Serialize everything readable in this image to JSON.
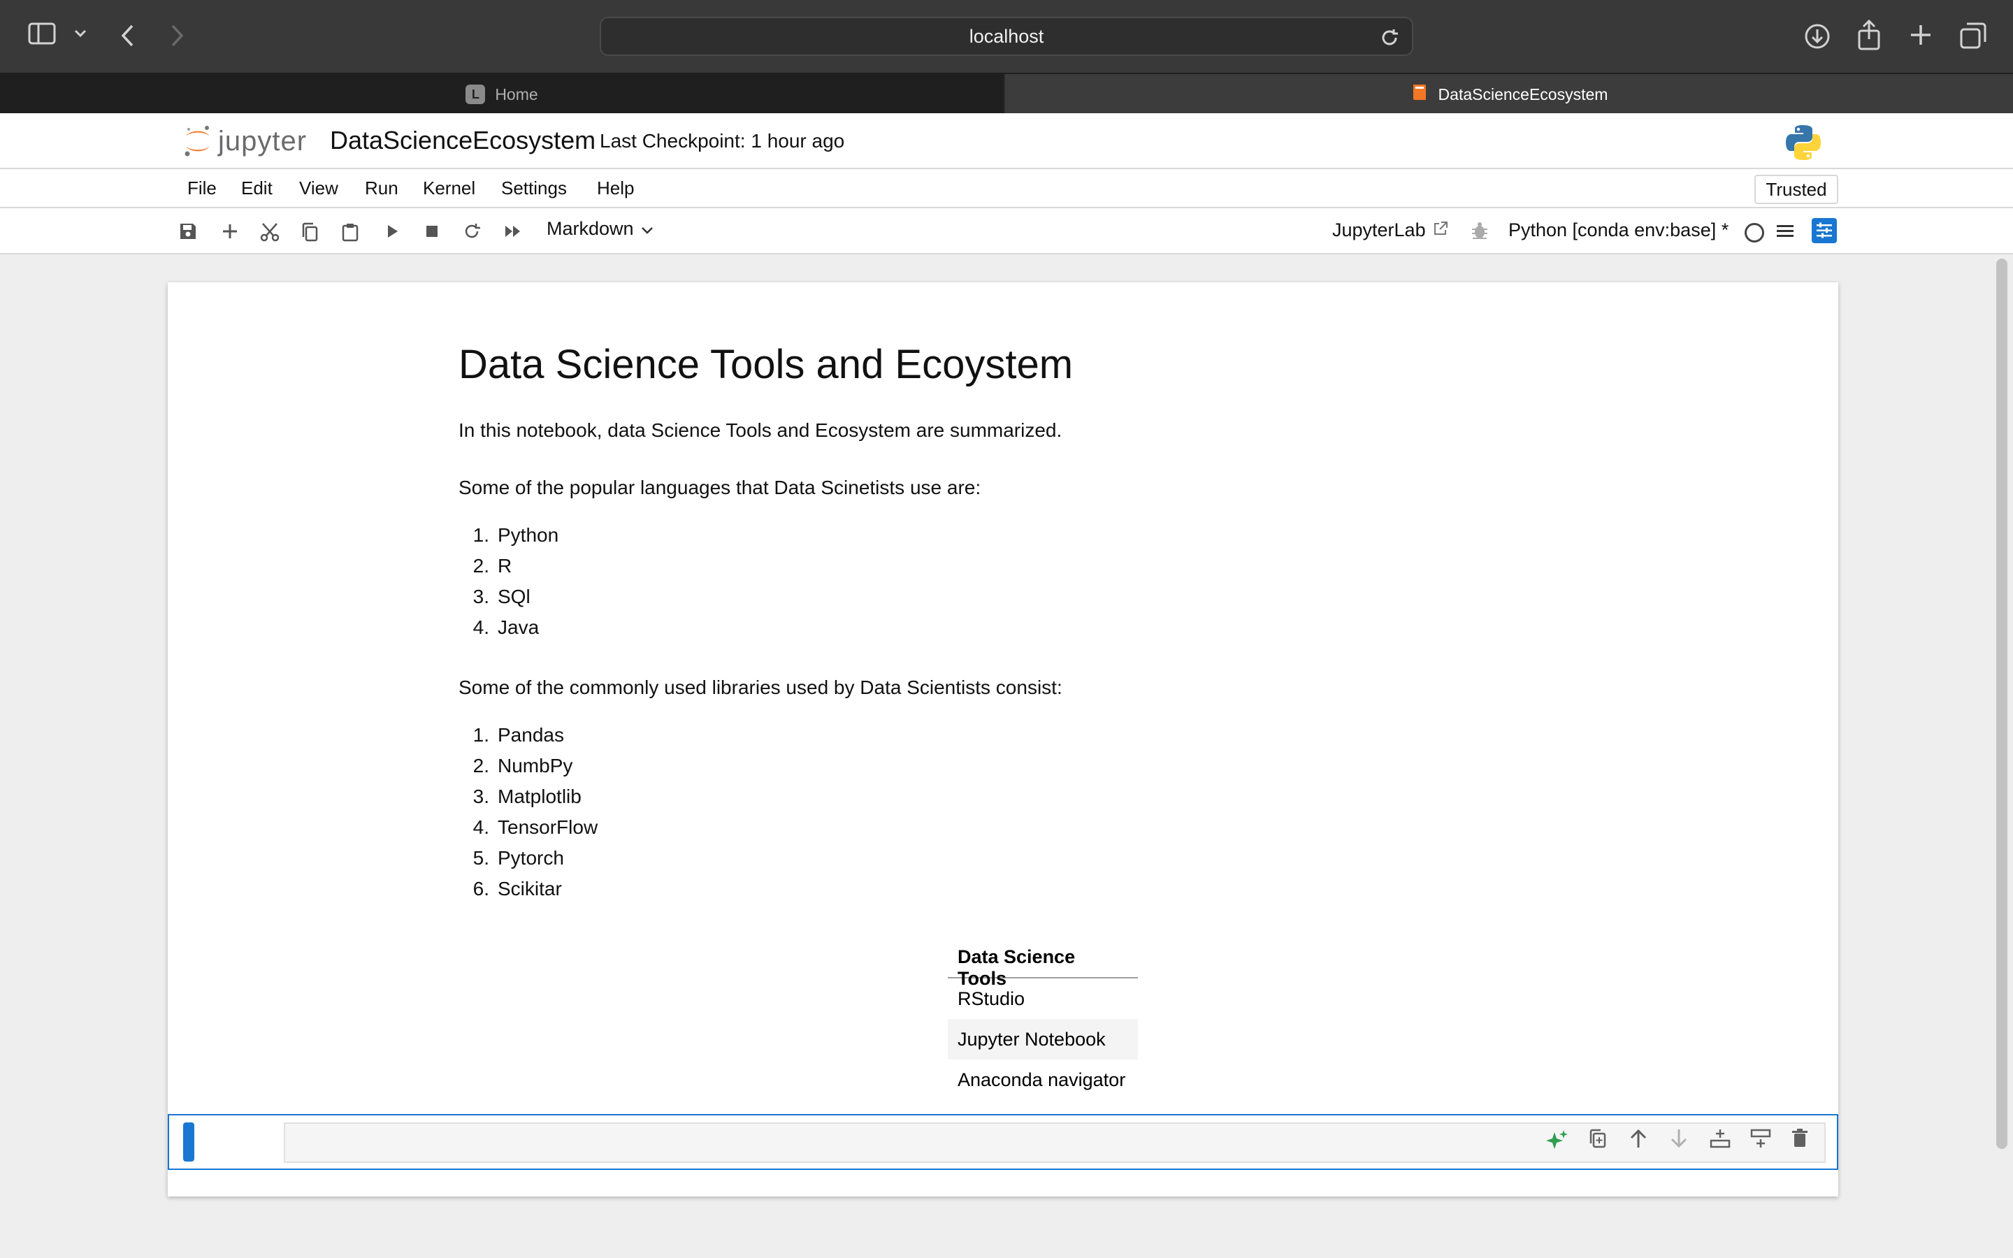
{
  "browser": {
    "url": "localhost",
    "tabs": [
      {
        "label": "Home",
        "favicon": "L",
        "active": false
      },
      {
        "label": "DataScienceEcosystem",
        "active": true
      }
    ]
  },
  "jupyter": {
    "logo_text": "jupyter",
    "notebook_name": "DataScienceEcosystem",
    "checkpoint": "Last Checkpoint: 1 hour ago",
    "menu": [
      "File",
      "Edit",
      "View",
      "Run",
      "Kernel",
      "Settings",
      "Help"
    ],
    "trusted": "Trusted",
    "cell_type": "Markdown",
    "jupyterlab_link": "JupyterLab",
    "kernel_name": "Python [conda env:base] *"
  },
  "notebook": {
    "title": "Data Science Tools and Ecoystem",
    "intro": "In this notebook, data Science Tools and Ecosystem are summarized.",
    "languages_heading": "Some of the popular languages that Data Scinetists use are:",
    "languages": [
      "Python",
      "R",
      "SQl",
      "Java"
    ],
    "libraries_heading": "Some of the commonly used libraries used by Data Scientists consist:",
    "libraries": [
      "Pandas",
      "NumbPy",
      "Matplotlib",
      "TensorFlow",
      "Pytorch",
      "Scikitar"
    ],
    "table": {
      "header": "Data Science Tools",
      "rows": [
        "RStudio",
        "Jupyter Notebook",
        "Anaconda navigator"
      ]
    }
  },
  "colors": {
    "accent": "#1976d2",
    "jupyter_orange": "#f37726",
    "browser_chrome": "#393939"
  }
}
